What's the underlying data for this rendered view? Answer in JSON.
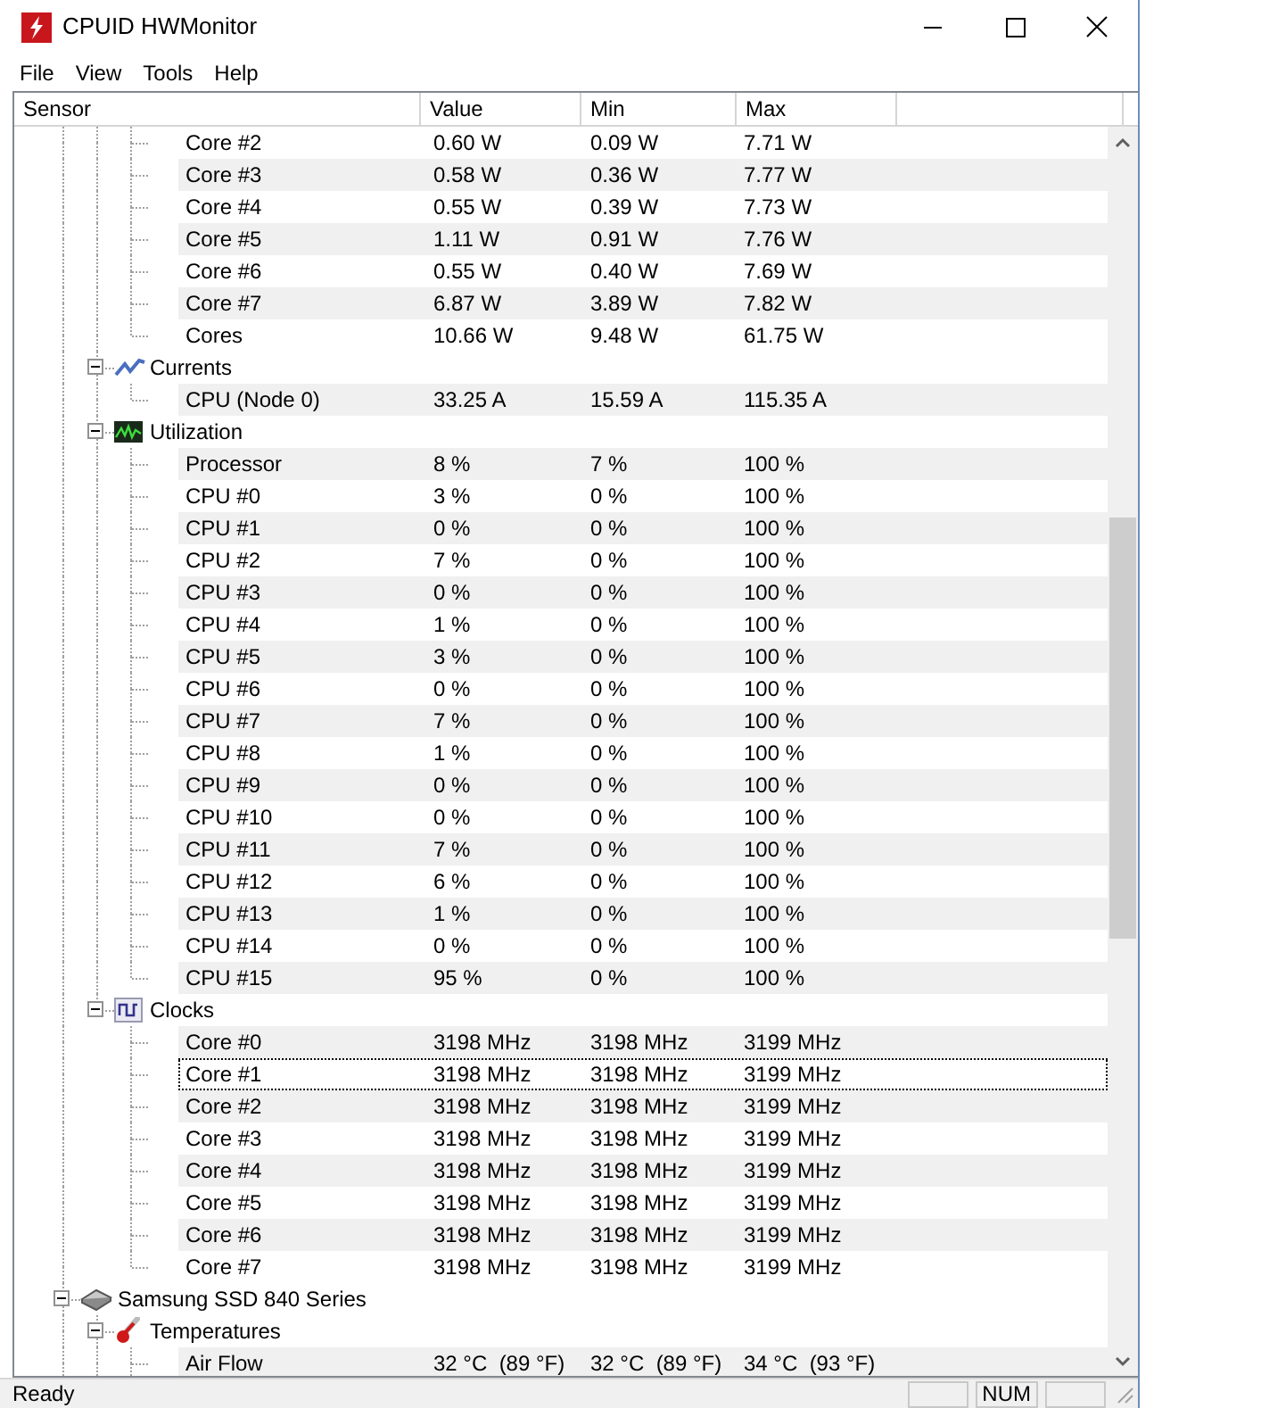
{
  "window": {
    "title": "CPUID HWMonitor"
  },
  "menu": [
    "File",
    "View",
    "Tools",
    "Help"
  ],
  "columns": [
    "Sensor",
    "Value",
    "Min",
    "Max"
  ],
  "tree": [
    {
      "scrolled_out": true,
      "children": [
        {
          "scrolled_out": true,
          "children": [
            {
              "label": "Core #2",
              "value": "0.60 W",
              "min": "0.09 W",
              "max": "7.71 W"
            },
            {
              "label": "Core #3",
              "value": "0.58 W",
              "min": "0.36 W",
              "max": "7.77 W"
            },
            {
              "label": "Core #4",
              "value": "0.55 W",
              "min": "0.39 W",
              "max": "7.73 W"
            },
            {
              "label": "Core #5",
              "value": "1.11 W",
              "min": "0.91 W",
              "max": "7.76 W"
            },
            {
              "label": "Core #6",
              "value": "0.55 W",
              "min": "0.40 W",
              "max": "7.69 W"
            },
            {
              "label": "Core #7",
              "value": "6.87 W",
              "min": "3.89 W",
              "max": "7.82 W"
            },
            {
              "label": "Cores",
              "value": "10.66 W",
              "min": "9.48 W",
              "max": "61.75 W"
            }
          ]
        },
        {
          "label": "Currents",
          "kind": "currents",
          "expanded": true,
          "children": [
            {
              "label": "CPU (Node 0)",
              "value": "33.25 A",
              "min": "15.59 A",
              "max": "115.35 A"
            }
          ]
        },
        {
          "label": "Utilization",
          "kind": "utilization",
          "expanded": true,
          "children": [
            {
              "label": "Processor",
              "value": "8 %",
              "min": "7 %",
              "max": "100 %"
            },
            {
              "label": "CPU #0",
              "value": "3 %",
              "min": "0 %",
              "max": "100 %"
            },
            {
              "label": "CPU #1",
              "value": "0 %",
              "min": "0 %",
              "max": "100 %"
            },
            {
              "label": "CPU #2",
              "value": "7 %",
              "min": "0 %",
              "max": "100 %"
            },
            {
              "label": "CPU #3",
              "value": "0 %",
              "min": "0 %",
              "max": "100 %"
            },
            {
              "label": "CPU #4",
              "value": "1 %",
              "min": "0 %",
              "max": "100 %"
            },
            {
              "label": "CPU #5",
              "value": "3 %",
              "min": "0 %",
              "max": "100 %"
            },
            {
              "label": "CPU #6",
              "value": "0 %",
              "min": "0 %",
              "max": "100 %"
            },
            {
              "label": "CPU #7",
              "value": "7 %",
              "min": "0 %",
              "max": "100 %"
            },
            {
              "label": "CPU #8",
              "value": "1 %",
              "min": "0 %",
              "max": "100 %"
            },
            {
              "label": "CPU #9",
              "value": "0 %",
              "min": "0 %",
              "max": "100 %"
            },
            {
              "label": "CPU #10",
              "value": "0 %",
              "min": "0 %",
              "max": "100 %"
            },
            {
              "label": "CPU #11",
              "value": "7 %",
              "min": "0 %",
              "max": "100 %"
            },
            {
              "label": "CPU #12",
              "value": "6 %",
              "min": "0 %",
              "max": "100 %"
            },
            {
              "label": "CPU #13",
              "value": "1 %",
              "min": "0 %",
              "max": "100 %"
            },
            {
              "label": "CPU #14",
              "value": "0 %",
              "min": "0 %",
              "max": "100 %"
            },
            {
              "label": "CPU #15",
              "value": "95 %",
              "min": "0 %",
              "max": "100 %"
            }
          ]
        },
        {
          "label": "Clocks",
          "kind": "clocks",
          "expanded": true,
          "children": [
            {
              "label": "Core #0",
              "value": "3198 MHz",
              "min": "3198 MHz",
              "max": "3199 MHz",
              "focused": false
            },
            {
              "label": "Core #1",
              "value": "3198 MHz",
              "min": "3198 MHz",
              "max": "3199 MHz",
              "focused": true
            },
            {
              "label": "Core #2",
              "value": "3198 MHz",
              "min": "3198 MHz",
              "max": "3199 MHz",
              "focused": false
            },
            {
              "label": "Core #3",
              "value": "3198 MHz",
              "min": "3198 MHz",
              "max": "3199 MHz",
              "focused": false
            },
            {
              "label": "Core #4",
              "value": "3198 MHz",
              "min": "3198 MHz",
              "max": "3199 MHz",
              "focused": false
            },
            {
              "label": "Core #5",
              "value": "3198 MHz",
              "min": "3198 MHz",
              "max": "3199 MHz",
              "focused": false
            },
            {
              "label": "Core #6",
              "value": "3198 MHz",
              "min": "3198 MHz",
              "max": "3199 MHz",
              "focused": false
            },
            {
              "label": "Core #7",
              "value": "3198 MHz",
              "min": "3198 MHz",
              "max": "3199 MHz",
              "focused": false
            }
          ]
        }
      ]
    },
    {
      "label": "Samsung SSD 840 Series",
      "kind": "drive",
      "expanded": true,
      "children": [
        {
          "label": "Temperatures",
          "kind": "temperatures",
          "expanded": true,
          "children": [
            {
              "label": "Air Flow",
              "value": "32 °C  (89 °F)",
              "min": "32 °C  (89 °F)",
              "max": "34 °C  (93 °F)"
            }
          ]
        }
      ]
    }
  ],
  "status_bar": {
    "text": "Ready",
    "panels": [
      {
        "kind": "blank"
      },
      {
        "kind": "text",
        "text": "NUM"
      },
      {
        "kind": "blank"
      }
    ]
  }
}
